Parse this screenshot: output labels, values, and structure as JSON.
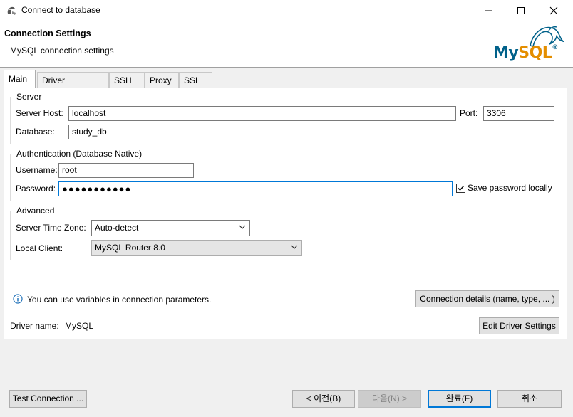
{
  "window": {
    "title": "Connect to database",
    "app_icon": "dbeaver-beaver-icon",
    "controls": {
      "minimize": "minimize-icon",
      "maximize": "maximize-icon",
      "close": "close-icon"
    }
  },
  "header": {
    "title": "Connection Settings",
    "subtitle": "MySQL connection settings",
    "logo_text": "MySQL",
    "logo_mark": "®"
  },
  "tabs": [
    {
      "label": "Main",
      "active": true
    },
    {
      "label": "Driver properties",
      "active": false
    },
    {
      "label": "SSH",
      "active": false
    },
    {
      "label": "Proxy",
      "active": false
    },
    {
      "label": "SSL",
      "active": false
    }
  ],
  "server": {
    "legend": "Server",
    "host_label": "Server Host:",
    "host_value": "localhost",
    "port_label": "Port:",
    "port_value": "3306",
    "database_label": "Database:",
    "database_value": "study_db"
  },
  "auth": {
    "legend": "Authentication (Database Native)",
    "username_label": "Username:",
    "username_value": "root",
    "password_label": "Password:",
    "password_masked": "●●●●●●●●●●●",
    "save_password_label": "Save password locally",
    "save_password_checked": true
  },
  "advanced": {
    "legend": "Advanced",
    "timezone_label": "Server Time Zone:",
    "timezone_value": "Auto-detect",
    "local_client_label": "Local Client:",
    "local_client_value": "MySQL Router 8.0"
  },
  "info": {
    "icon": "info-icon",
    "text": "You can use variables in connection parameters.",
    "details_button": "Connection details (name, type, ... )"
  },
  "driver": {
    "label": "Driver name:",
    "value": "MySQL",
    "edit_button": "Edit Driver Settings"
  },
  "footer": {
    "test_connection": "Test Connection ...",
    "back": "< 이전(B)",
    "next": "다음(N) >",
    "finish": "완료(F)",
    "cancel": "취소"
  },
  "colors": {
    "accent": "#0078d7",
    "mysql_blue": "#00618a",
    "mysql_orange": "#e48e00",
    "info_blue": "#1c6fb8"
  }
}
